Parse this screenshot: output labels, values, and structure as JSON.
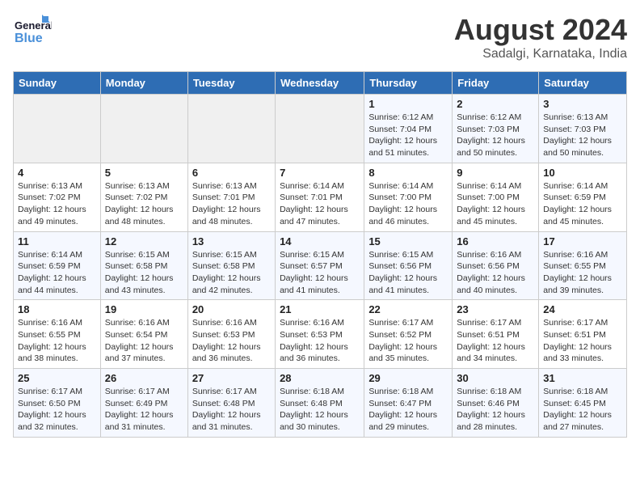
{
  "header": {
    "logo_line1": "General",
    "logo_line2": "Blue",
    "month_year": "August 2024",
    "location": "Sadalgi, Karnataka, India"
  },
  "days_of_week": [
    "Sunday",
    "Monday",
    "Tuesday",
    "Wednesday",
    "Thursday",
    "Friday",
    "Saturday"
  ],
  "weeks": [
    [
      {
        "day": "",
        "detail": ""
      },
      {
        "day": "",
        "detail": ""
      },
      {
        "day": "",
        "detail": ""
      },
      {
        "day": "",
        "detail": ""
      },
      {
        "day": "1",
        "detail": "Sunrise: 6:12 AM\nSunset: 7:04 PM\nDaylight: 12 hours and 51 minutes."
      },
      {
        "day": "2",
        "detail": "Sunrise: 6:12 AM\nSunset: 7:03 PM\nDaylight: 12 hours and 50 minutes."
      },
      {
        "day": "3",
        "detail": "Sunrise: 6:13 AM\nSunset: 7:03 PM\nDaylight: 12 hours and 50 minutes."
      }
    ],
    [
      {
        "day": "4",
        "detail": "Sunrise: 6:13 AM\nSunset: 7:02 PM\nDaylight: 12 hours and 49 minutes."
      },
      {
        "day": "5",
        "detail": "Sunrise: 6:13 AM\nSunset: 7:02 PM\nDaylight: 12 hours and 48 minutes."
      },
      {
        "day": "6",
        "detail": "Sunrise: 6:13 AM\nSunset: 7:01 PM\nDaylight: 12 hours and 48 minutes."
      },
      {
        "day": "7",
        "detail": "Sunrise: 6:14 AM\nSunset: 7:01 PM\nDaylight: 12 hours and 47 minutes."
      },
      {
        "day": "8",
        "detail": "Sunrise: 6:14 AM\nSunset: 7:00 PM\nDaylight: 12 hours and 46 minutes."
      },
      {
        "day": "9",
        "detail": "Sunrise: 6:14 AM\nSunset: 7:00 PM\nDaylight: 12 hours and 45 minutes."
      },
      {
        "day": "10",
        "detail": "Sunrise: 6:14 AM\nSunset: 6:59 PM\nDaylight: 12 hours and 45 minutes."
      }
    ],
    [
      {
        "day": "11",
        "detail": "Sunrise: 6:14 AM\nSunset: 6:59 PM\nDaylight: 12 hours and 44 minutes."
      },
      {
        "day": "12",
        "detail": "Sunrise: 6:15 AM\nSunset: 6:58 PM\nDaylight: 12 hours and 43 minutes."
      },
      {
        "day": "13",
        "detail": "Sunrise: 6:15 AM\nSunset: 6:58 PM\nDaylight: 12 hours and 42 minutes."
      },
      {
        "day": "14",
        "detail": "Sunrise: 6:15 AM\nSunset: 6:57 PM\nDaylight: 12 hours and 41 minutes."
      },
      {
        "day": "15",
        "detail": "Sunrise: 6:15 AM\nSunset: 6:56 PM\nDaylight: 12 hours and 41 minutes."
      },
      {
        "day": "16",
        "detail": "Sunrise: 6:16 AM\nSunset: 6:56 PM\nDaylight: 12 hours and 40 minutes."
      },
      {
        "day": "17",
        "detail": "Sunrise: 6:16 AM\nSunset: 6:55 PM\nDaylight: 12 hours and 39 minutes."
      }
    ],
    [
      {
        "day": "18",
        "detail": "Sunrise: 6:16 AM\nSunset: 6:55 PM\nDaylight: 12 hours and 38 minutes."
      },
      {
        "day": "19",
        "detail": "Sunrise: 6:16 AM\nSunset: 6:54 PM\nDaylight: 12 hours and 37 minutes."
      },
      {
        "day": "20",
        "detail": "Sunrise: 6:16 AM\nSunset: 6:53 PM\nDaylight: 12 hours and 36 minutes."
      },
      {
        "day": "21",
        "detail": "Sunrise: 6:16 AM\nSunset: 6:53 PM\nDaylight: 12 hours and 36 minutes."
      },
      {
        "day": "22",
        "detail": "Sunrise: 6:17 AM\nSunset: 6:52 PM\nDaylight: 12 hours and 35 minutes."
      },
      {
        "day": "23",
        "detail": "Sunrise: 6:17 AM\nSunset: 6:51 PM\nDaylight: 12 hours and 34 minutes."
      },
      {
        "day": "24",
        "detail": "Sunrise: 6:17 AM\nSunset: 6:51 PM\nDaylight: 12 hours and 33 minutes."
      }
    ],
    [
      {
        "day": "25",
        "detail": "Sunrise: 6:17 AM\nSunset: 6:50 PM\nDaylight: 12 hours and 32 minutes."
      },
      {
        "day": "26",
        "detail": "Sunrise: 6:17 AM\nSunset: 6:49 PM\nDaylight: 12 hours and 31 minutes."
      },
      {
        "day": "27",
        "detail": "Sunrise: 6:17 AM\nSunset: 6:48 PM\nDaylight: 12 hours and 31 minutes."
      },
      {
        "day": "28",
        "detail": "Sunrise: 6:18 AM\nSunset: 6:48 PM\nDaylight: 12 hours and 30 minutes."
      },
      {
        "day": "29",
        "detail": "Sunrise: 6:18 AM\nSunset: 6:47 PM\nDaylight: 12 hours and 29 minutes."
      },
      {
        "day": "30",
        "detail": "Sunrise: 6:18 AM\nSunset: 6:46 PM\nDaylight: 12 hours and 28 minutes."
      },
      {
        "day": "31",
        "detail": "Sunrise: 6:18 AM\nSunset: 6:45 PM\nDaylight: 12 hours and 27 minutes."
      }
    ]
  ]
}
